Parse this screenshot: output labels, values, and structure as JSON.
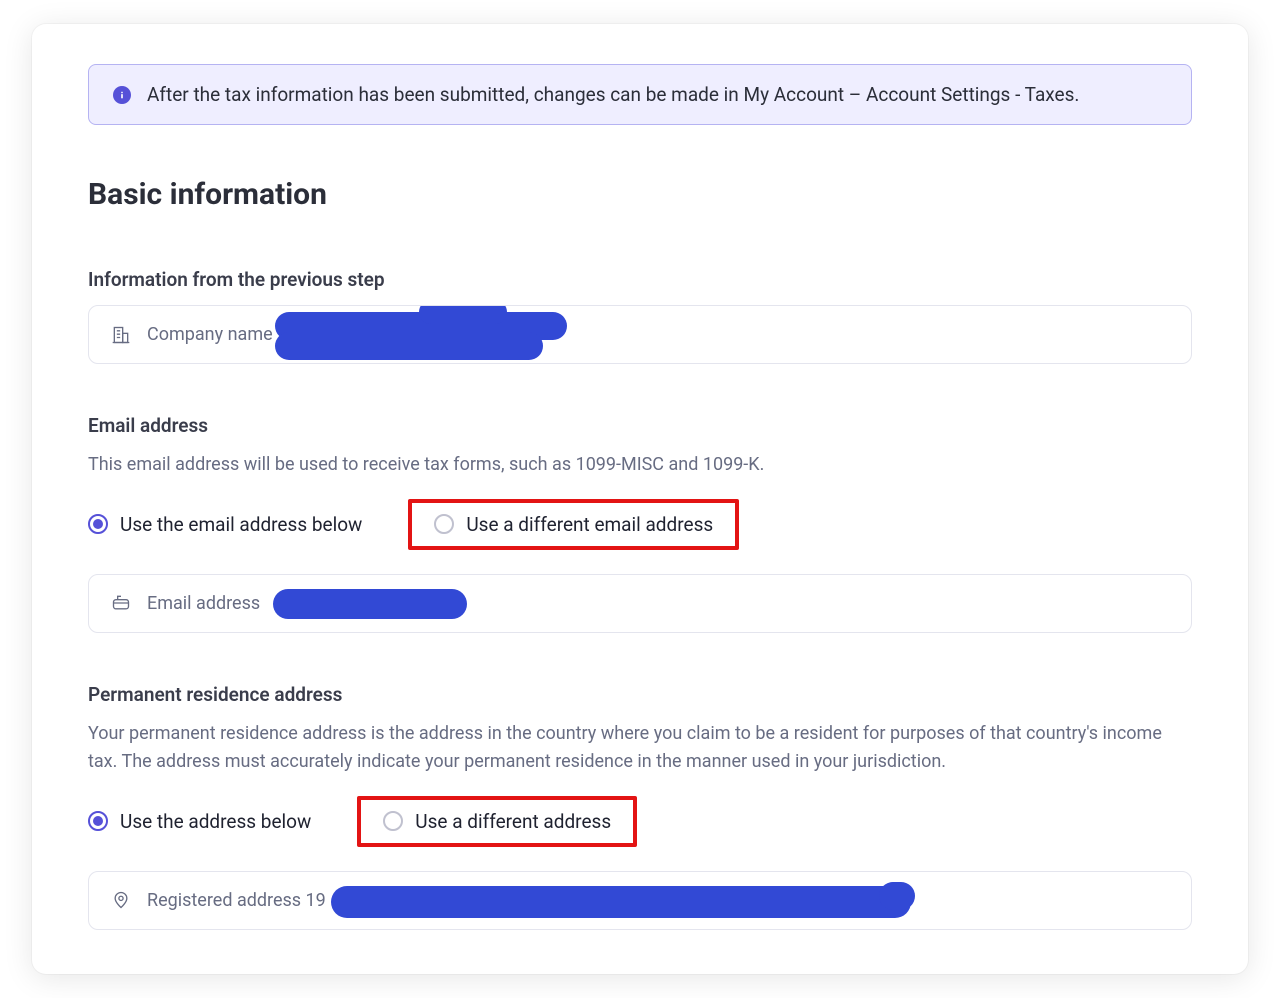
{
  "banner": {
    "text": "After the tax information has been submitted, changes can be made in My Account – Account Settings - Taxes."
  },
  "headings": {
    "basic": "Basic information",
    "prev_step": "Information from the previous step",
    "email": "Email address",
    "email_desc": "This email address will be used to receive tax forms, such as 1099-MISC and 1099-K.",
    "address": "Permanent residence address",
    "address_desc": "Your permanent residence address is the address in the country where you claim to be a resident for purposes of that country's income tax. The address must accurately indicate your permanent residence in the manner used in your jurisdiction."
  },
  "fields": {
    "company_label": "Company name",
    "email_label": "Email address",
    "registered_label": "Registered address 19"
  },
  "radios": {
    "email_use_below": "Use the email address below",
    "email_use_diff": "Use a different email address",
    "addr_use_below": "Use the address below",
    "addr_use_diff": "Use a different address"
  }
}
